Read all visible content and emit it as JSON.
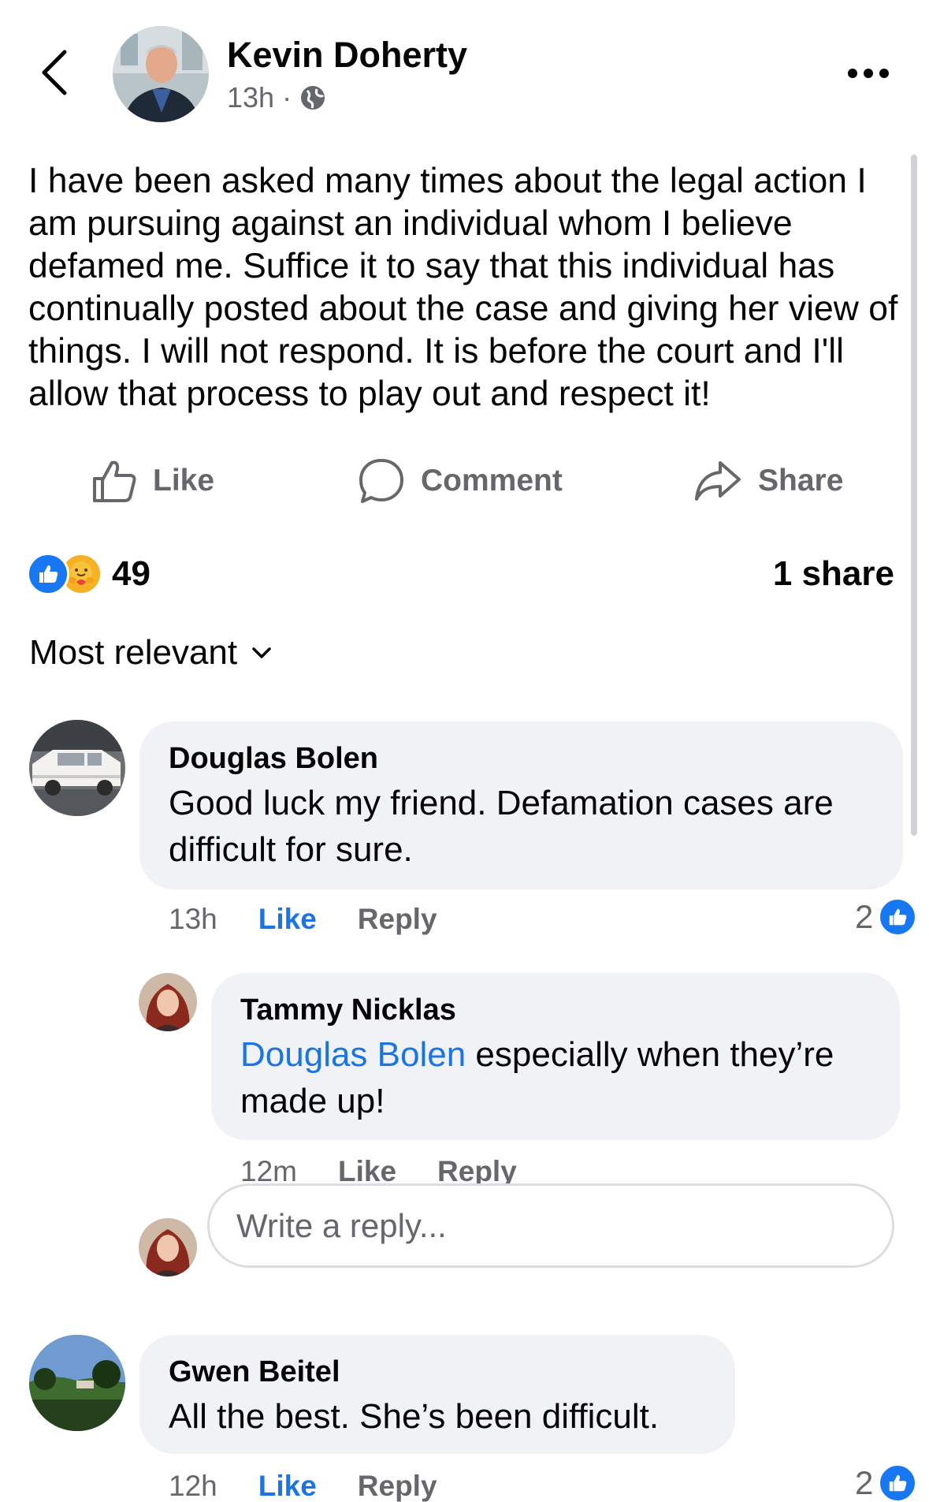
{
  "post": {
    "author": "Kevin Doherty",
    "time": "13h",
    "separator": "·",
    "privacy_icon": "globe-icon",
    "text": "I have been asked many times about the legal action I am pursuing against an individual whom I believe defamed me.  Suffice it to say that this individual has continually posted about the case and giving her view of things. I will not respond.  It is before the court and I'll allow that process to play out and respect it!",
    "reaction_count": "49",
    "share_count": "1 share"
  },
  "actions": {
    "like": "Like",
    "comment": "Comment",
    "share": "Share"
  },
  "sort": {
    "label": "Most relevant"
  },
  "comments": [
    {
      "name": "Douglas Bolen",
      "text": "Good luck my friend. Defamation cases are difficult for sure.",
      "time": "13h",
      "like": "Like",
      "reply": "Reply",
      "likes": "2"
    },
    {
      "name": "Tammy Nicklas",
      "mention": "Douglas Bolen",
      "text": " especially when they’re made up!",
      "time": "12m",
      "like": "Like",
      "reply": "Reply"
    },
    {
      "name": "Gwen Beitel",
      "text": "All the best.  She’s been difficult.",
      "time": "12h",
      "like": "Like",
      "reply": "Reply",
      "likes": "2"
    }
  ],
  "reply_box": {
    "placeholder": "Write a reply..."
  },
  "colors": {
    "accent": "#1b74e4",
    "bubble": "#f0f2f5",
    "muted": "#65676b"
  }
}
